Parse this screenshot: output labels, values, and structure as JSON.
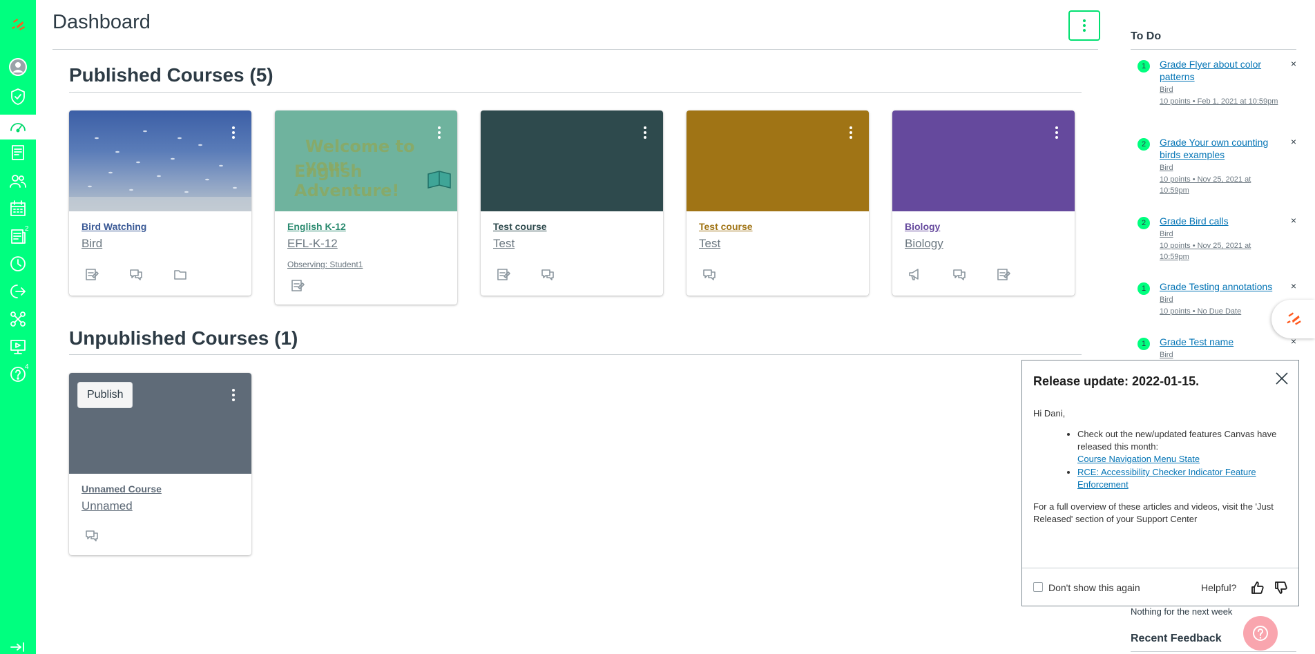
{
  "page_title": "Dashboard",
  "nav": {
    "items": [
      {
        "name": "account",
        "badge": ""
      },
      {
        "name": "admin",
        "badge": ""
      },
      {
        "name": "dashboard",
        "badge": ""
      },
      {
        "name": "courses",
        "badge": ""
      },
      {
        "name": "groups",
        "badge": ""
      },
      {
        "name": "calendar",
        "badge": ""
      },
      {
        "name": "inbox",
        "badge": "2"
      },
      {
        "name": "history",
        "badge": ""
      },
      {
        "name": "logout",
        "badge": ""
      },
      {
        "name": "commons",
        "badge": ""
      },
      {
        "name": "studio",
        "badge": ""
      },
      {
        "name": "help",
        "badge": "4"
      }
    ]
  },
  "published": {
    "heading": "Published Courses (5)",
    "cards": [
      {
        "name": "Bird Watching",
        "code": "Bird",
        "color": "#3b5a96",
        "observing": ""
      },
      {
        "name": "English K-12",
        "code": "EFL-K-12",
        "color": "#6fb39e",
        "observing": "Observing: Student1",
        "hero_text_1": "Welcome to your",
        "hero_text_2": "English Adventure!"
      },
      {
        "name": "Test course",
        "code": "Test",
        "color": "#2e4a4d",
        "observing": ""
      },
      {
        "name": "Test course",
        "code": "Test",
        "color": "#a07415",
        "observing": ""
      },
      {
        "name": "Biology",
        "code": "Biology",
        "color": "#65499d",
        "observing": ""
      }
    ]
  },
  "unpublished": {
    "heading": "Unpublished Courses (1)",
    "cards": [
      {
        "name": "Unnamed Course",
        "code": "Unnamed",
        "color": "#5f6b78",
        "publish_label": "Publish"
      }
    ]
  },
  "todo": {
    "heading": "To Do",
    "items": [
      {
        "count": "1",
        "title": "Grade Flyer about color patterns",
        "course": "Bird",
        "meta": "10 points • Feb 1, 2021 at 10:59pm"
      },
      {
        "count": "2",
        "title": "Grade Your own counting birds examples",
        "course": "Bird",
        "meta": "10 points • Nov 25, 2021 at 10:59pm"
      },
      {
        "count": "2",
        "title": "Grade Bird calls",
        "course": "Bird",
        "meta": "10 points • Nov 25, 2021 at 10:59pm"
      },
      {
        "count": "1",
        "title": "Grade Testing annotations",
        "course": "Bird",
        "meta": "10 points • No Due Date"
      },
      {
        "count": "1",
        "title": "Grade Test name",
        "course": "Bird",
        "meta": ""
      }
    ],
    "dismiss": "×",
    "nothing": "Nothing for the next week",
    "recent_feedback": "Recent Feedback"
  },
  "modal": {
    "title": "Release update: 2022-01-15.",
    "greeting": "Hi Dani,",
    "intro": "Check out the new/updated features Canvas have released this month:",
    "link1": "Course Navigation Menu State",
    "link2": "RCE: Accessibility Checker Indicator Feature Enforcement",
    "overview": "For a full overview of these articles and videos, visit the 'Just Released' section of your Support Center",
    "dont_show": "Don't show this again",
    "helpful": "Helpful?"
  },
  "colors": {
    "nav": "#00ff7f",
    "accent": "#00e070",
    "link": "#0374b5"
  }
}
